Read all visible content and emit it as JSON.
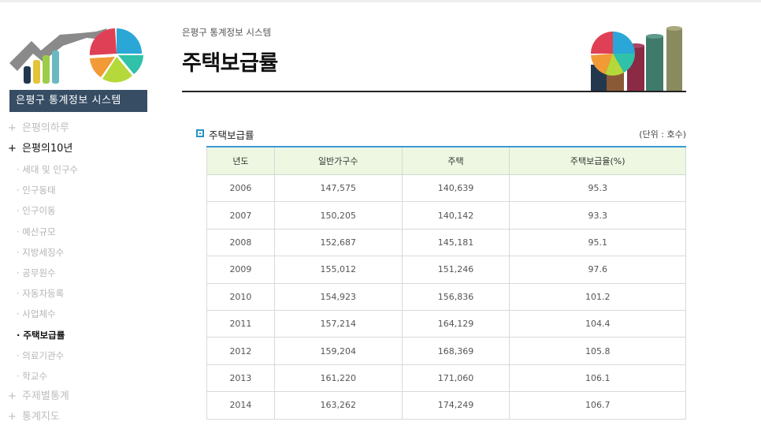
{
  "sidebar": {
    "system_label": "은평구 통계정보 시스템",
    "menu_top": [
      {
        "plus": "+",
        "label": "은평의하루"
      },
      {
        "plus": "+",
        "label": "은평의10년"
      }
    ],
    "submenu": [
      "· 세대 및 인구수",
      "· 인구동태",
      "· 인구이동",
      "· 예산규모",
      "· 지방세징수",
      "· 공무원수",
      "· 자동차등록",
      "· 사업체수",
      "· 주택보급률",
      "· 의료기관수",
      "· 학교수"
    ],
    "menu_bottom": [
      {
        "plus": "+",
        "label": "주제별통계"
      },
      {
        "plus": "+",
        "label": "통계지도"
      }
    ]
  },
  "header": {
    "breadcrumb": "은평구 통계정보 시스템",
    "title": "주택보급률"
  },
  "section": {
    "title": "주택보급률",
    "unit": "(단위 : 호수)"
  },
  "table": {
    "headers": [
      "년도",
      "일반가구수",
      "주택",
      "주택보급율(%)"
    ],
    "rows": [
      [
        "2006",
        "147,575",
        "140,639",
        "95.3"
      ],
      [
        "2007",
        "150,205",
        "140,142",
        "93.3"
      ],
      [
        "2008",
        "152,687",
        "145,181",
        "95.1"
      ],
      [
        "2009",
        "155,012",
        "151,246",
        "97.6"
      ],
      [
        "2010",
        "154,923",
        "156,836",
        "101.2"
      ],
      [
        "2011",
        "157,214",
        "164,129",
        "104.4"
      ],
      [
        "2012",
        "159,204",
        "168,369",
        "105.8"
      ],
      [
        "2013",
        "161,220",
        "171,060",
        "106.1"
      ],
      [
        "2014",
        "163,262",
        "174,249",
        "106.7"
      ]
    ]
  },
  "colors": {
    "accent_blue": "#3a9ad8",
    "sidebar_box": "#364d64",
    "table_header_bg": "#edf7e1"
  },
  "icons": [
    "logo-chart-icon",
    "header-chart-art-icon",
    "section-bullet-icon"
  ]
}
